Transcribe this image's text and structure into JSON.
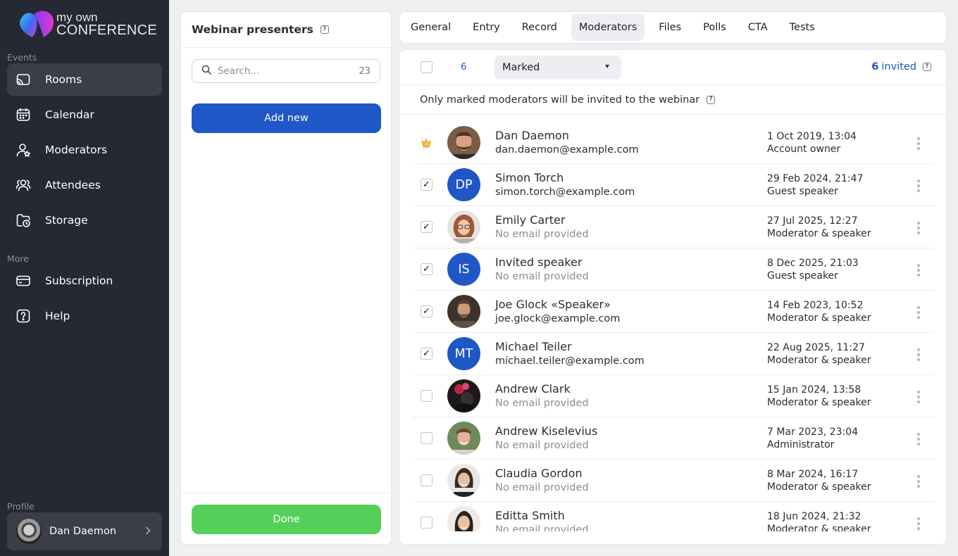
{
  "app": {
    "logo_line1": "my own",
    "logo_line2": "CONFERENCE"
  },
  "sidebar": {
    "section_events": "Events",
    "section_more": "More",
    "section_profile": "Profile",
    "items": [
      {
        "label": "Rooms",
        "icon": "cast-icon",
        "active": true
      },
      {
        "label": "Calendar",
        "icon": "calendar-icon"
      },
      {
        "label": "Moderators",
        "icon": "user-star-icon"
      },
      {
        "label": "Attendees",
        "icon": "users-icon"
      },
      {
        "label": "Storage",
        "icon": "folder-clock-icon"
      },
      {
        "label": "Subscription",
        "icon": "card-icon"
      },
      {
        "label": "Help",
        "icon": "help-icon"
      }
    ],
    "profile_name": "Dan Daemon"
  },
  "presenters_panel": {
    "title": "Webinar presenters",
    "search_placeholder": "Search...",
    "search_count": "23",
    "add_label": "Add new",
    "done_label": "Done"
  },
  "tabs": [
    {
      "label": "General"
    },
    {
      "label": "Entry"
    },
    {
      "label": "Record"
    },
    {
      "label": "Moderators",
      "active": true
    },
    {
      "label": "Files"
    },
    {
      "label": "Polls"
    },
    {
      "label": "CTA"
    },
    {
      "label": "Tests"
    }
  ],
  "moderators": {
    "selected_count": "6",
    "filter_value": "Marked",
    "invited_count": "6",
    "invited_label": "invited",
    "note": "Only marked moderators will be invited to the webinar",
    "rows": [
      {
        "name": "Dan Daemon",
        "email": "dan.daemon@example.com",
        "date": "1 Oct 2019, 13:04",
        "role": "Account owner",
        "owner": true,
        "avatar": "photo"
      },
      {
        "name": "Simon Torch",
        "email": "simon.torch@example.com",
        "date": "29 Feb 2024, 21:47",
        "role": "Guest speaker",
        "checked": true,
        "initials": "DP"
      },
      {
        "name": "Emily Carter",
        "email": "No email provided",
        "date": "27 Jul 2025, 12:27",
        "role": "Moderator & speaker",
        "checked": true,
        "avatar": "photo"
      },
      {
        "name": "Invited speaker",
        "email": "No email provided",
        "date": "8 Dec 2025, 21:03",
        "role": "Guest speaker",
        "checked": true,
        "initials": "IS"
      },
      {
        "name": "Joe Glock «Speaker»",
        "email": "joe.glock@example.com",
        "date": "14 Feb 2023, 10:52",
        "role": "Moderator & speaker",
        "checked": true,
        "avatar": "photo"
      },
      {
        "name": "Michael Teiler",
        "email": "michael.teiler@example.com",
        "date": "22 Aug 2025, 11:27",
        "role": "Moderator & speaker",
        "checked": true,
        "initials": "MT"
      },
      {
        "name": "Andrew Clark",
        "email": "No email provided",
        "date": "15 Jan 2024, 13:58",
        "role": "Moderator & speaker",
        "checked": false,
        "avatar": "photo"
      },
      {
        "name": "Andrew Kiselevius",
        "email": "No email provided",
        "date": "7 Mar 2023, 23:04",
        "role": "Administrator",
        "checked": false,
        "avatar": "photo"
      },
      {
        "name": "Claudia Gordon",
        "email": "No email provided",
        "date": "8 Mar 2024, 16:17",
        "role": "Moderator & speaker",
        "checked": false,
        "avatar": "photo"
      },
      {
        "name": "Editta Smith",
        "email": "No email provided",
        "date": "18 Jun 2024, 21:32",
        "role": "Moderator & speaker",
        "checked": false,
        "avatar": "photo"
      }
    ]
  },
  "colors": {
    "accent": "#1f57c7",
    "done": "#54d05a",
    "sidebar_bg": "#262833"
  }
}
